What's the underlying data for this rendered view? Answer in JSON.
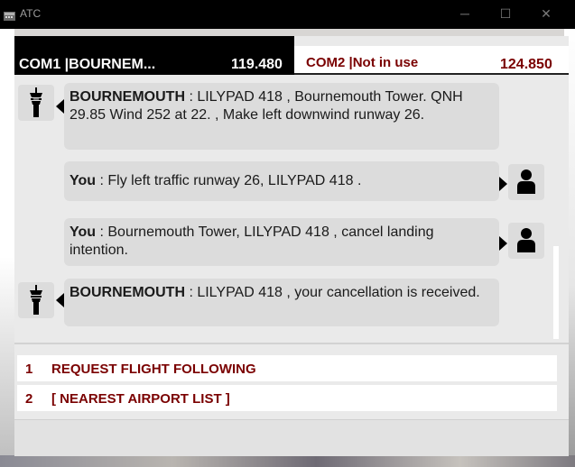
{
  "window": {
    "title": "ATC",
    "minimize_glyph": "─",
    "maximize_glyph": "☐",
    "close_glyph": "✕"
  },
  "com1": {
    "label": "COM1 |BOURNEM...",
    "frequency": "119.480"
  },
  "com2": {
    "label": "COM2 |Not in use",
    "frequency": "124.850"
  },
  "messages": [
    {
      "speaker": "BOURNEMOUTH",
      "text": " : LILYPAD 418 , Bournemouth Tower. QNH 29.85 Wind 252 at 22. , Make left downwind runway 26.",
      "side": "atc",
      "icon": "control-tower-icon"
    },
    {
      "speaker": "You",
      "text": " : Fly left traffic runway 26, LILYPAD 418 .",
      "side": "user",
      "icon": "pilot-icon"
    },
    {
      "speaker": "You",
      "text": " : Bournemouth Tower, LILYPAD 418 , cancel landing intention.",
      "side": "user",
      "icon": "pilot-icon"
    },
    {
      "speaker": "BOURNEMOUTH",
      "text": " : LILYPAD 418 , your cancellation is received.",
      "side": "atc",
      "icon": "control-tower-icon"
    }
  ],
  "options": [
    {
      "number": "1",
      "text": "REQUEST FLIGHT FOLLOWING"
    },
    {
      "number": "2",
      "text": "[ NEAREST AIRPORT LIST ]"
    }
  ],
  "colors": {
    "titlebar": "#000000",
    "com_active_bg": "#000000",
    "com_inactive_text": "#7a0000",
    "bubble": "#dcdcdc",
    "option_text": "#7a0000"
  }
}
